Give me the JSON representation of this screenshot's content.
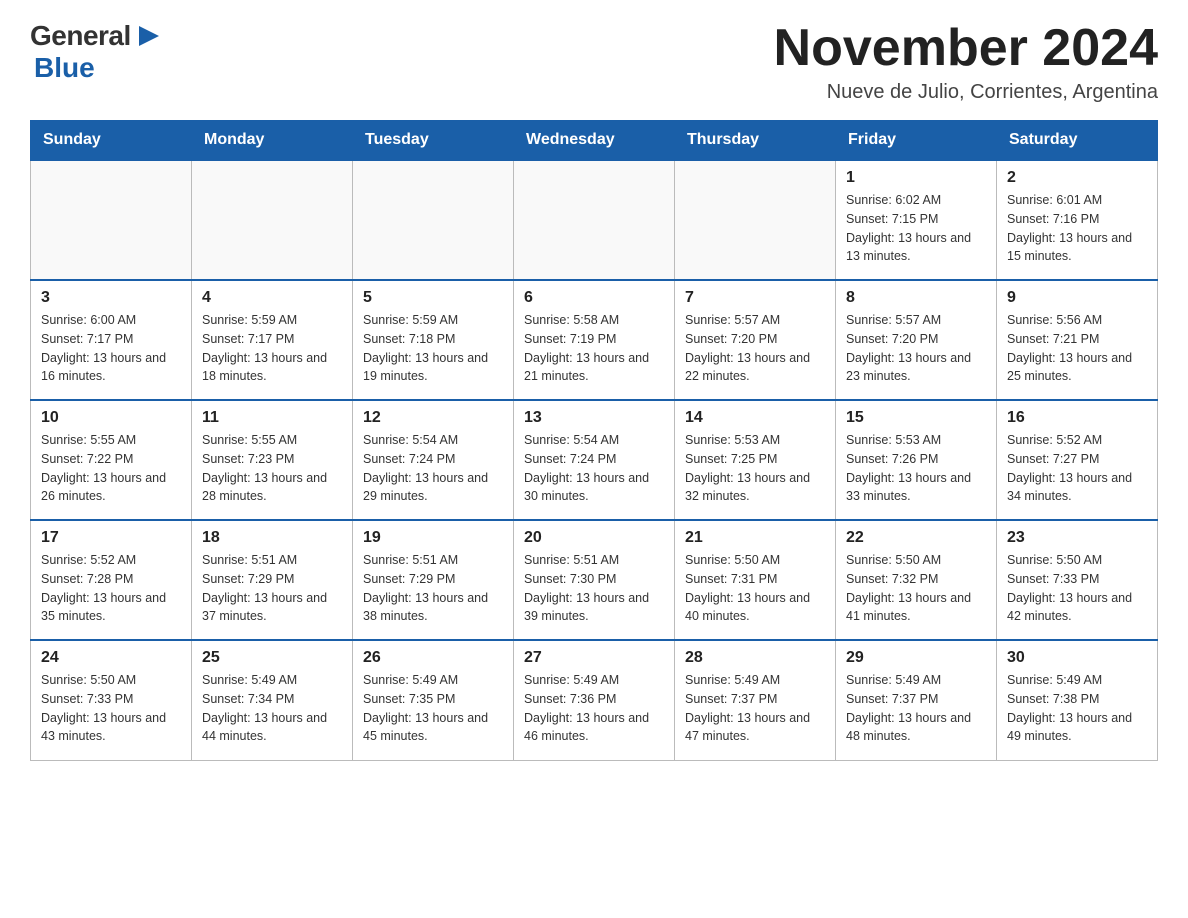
{
  "logo": {
    "general_text": "General",
    "blue_text": "Blue"
  },
  "header": {
    "month_year": "November 2024",
    "location": "Nueve de Julio, Corrientes, Argentina"
  },
  "days_of_week": [
    "Sunday",
    "Monday",
    "Tuesday",
    "Wednesday",
    "Thursday",
    "Friday",
    "Saturday"
  ],
  "weeks": [
    [
      {
        "day": "",
        "info": ""
      },
      {
        "day": "",
        "info": ""
      },
      {
        "day": "",
        "info": ""
      },
      {
        "day": "",
        "info": ""
      },
      {
        "day": "",
        "info": ""
      },
      {
        "day": "1",
        "info": "Sunrise: 6:02 AM\nSunset: 7:15 PM\nDaylight: 13 hours and 13 minutes."
      },
      {
        "day": "2",
        "info": "Sunrise: 6:01 AM\nSunset: 7:16 PM\nDaylight: 13 hours and 15 minutes."
      }
    ],
    [
      {
        "day": "3",
        "info": "Sunrise: 6:00 AM\nSunset: 7:17 PM\nDaylight: 13 hours and 16 minutes."
      },
      {
        "day": "4",
        "info": "Sunrise: 5:59 AM\nSunset: 7:17 PM\nDaylight: 13 hours and 18 minutes."
      },
      {
        "day": "5",
        "info": "Sunrise: 5:59 AM\nSunset: 7:18 PM\nDaylight: 13 hours and 19 minutes."
      },
      {
        "day": "6",
        "info": "Sunrise: 5:58 AM\nSunset: 7:19 PM\nDaylight: 13 hours and 21 minutes."
      },
      {
        "day": "7",
        "info": "Sunrise: 5:57 AM\nSunset: 7:20 PM\nDaylight: 13 hours and 22 minutes."
      },
      {
        "day": "8",
        "info": "Sunrise: 5:57 AM\nSunset: 7:20 PM\nDaylight: 13 hours and 23 minutes."
      },
      {
        "day": "9",
        "info": "Sunrise: 5:56 AM\nSunset: 7:21 PM\nDaylight: 13 hours and 25 minutes."
      }
    ],
    [
      {
        "day": "10",
        "info": "Sunrise: 5:55 AM\nSunset: 7:22 PM\nDaylight: 13 hours and 26 minutes."
      },
      {
        "day": "11",
        "info": "Sunrise: 5:55 AM\nSunset: 7:23 PM\nDaylight: 13 hours and 28 minutes."
      },
      {
        "day": "12",
        "info": "Sunrise: 5:54 AM\nSunset: 7:24 PM\nDaylight: 13 hours and 29 minutes."
      },
      {
        "day": "13",
        "info": "Sunrise: 5:54 AM\nSunset: 7:24 PM\nDaylight: 13 hours and 30 minutes."
      },
      {
        "day": "14",
        "info": "Sunrise: 5:53 AM\nSunset: 7:25 PM\nDaylight: 13 hours and 32 minutes."
      },
      {
        "day": "15",
        "info": "Sunrise: 5:53 AM\nSunset: 7:26 PM\nDaylight: 13 hours and 33 minutes."
      },
      {
        "day": "16",
        "info": "Sunrise: 5:52 AM\nSunset: 7:27 PM\nDaylight: 13 hours and 34 minutes."
      }
    ],
    [
      {
        "day": "17",
        "info": "Sunrise: 5:52 AM\nSunset: 7:28 PM\nDaylight: 13 hours and 35 minutes."
      },
      {
        "day": "18",
        "info": "Sunrise: 5:51 AM\nSunset: 7:29 PM\nDaylight: 13 hours and 37 minutes."
      },
      {
        "day": "19",
        "info": "Sunrise: 5:51 AM\nSunset: 7:29 PM\nDaylight: 13 hours and 38 minutes."
      },
      {
        "day": "20",
        "info": "Sunrise: 5:51 AM\nSunset: 7:30 PM\nDaylight: 13 hours and 39 minutes."
      },
      {
        "day": "21",
        "info": "Sunrise: 5:50 AM\nSunset: 7:31 PM\nDaylight: 13 hours and 40 minutes."
      },
      {
        "day": "22",
        "info": "Sunrise: 5:50 AM\nSunset: 7:32 PM\nDaylight: 13 hours and 41 minutes."
      },
      {
        "day": "23",
        "info": "Sunrise: 5:50 AM\nSunset: 7:33 PM\nDaylight: 13 hours and 42 minutes."
      }
    ],
    [
      {
        "day": "24",
        "info": "Sunrise: 5:50 AM\nSunset: 7:33 PM\nDaylight: 13 hours and 43 minutes."
      },
      {
        "day": "25",
        "info": "Sunrise: 5:49 AM\nSunset: 7:34 PM\nDaylight: 13 hours and 44 minutes."
      },
      {
        "day": "26",
        "info": "Sunrise: 5:49 AM\nSunset: 7:35 PM\nDaylight: 13 hours and 45 minutes."
      },
      {
        "day": "27",
        "info": "Sunrise: 5:49 AM\nSunset: 7:36 PM\nDaylight: 13 hours and 46 minutes."
      },
      {
        "day": "28",
        "info": "Sunrise: 5:49 AM\nSunset: 7:37 PM\nDaylight: 13 hours and 47 minutes."
      },
      {
        "day": "29",
        "info": "Sunrise: 5:49 AM\nSunset: 7:37 PM\nDaylight: 13 hours and 48 minutes."
      },
      {
        "day": "30",
        "info": "Sunrise: 5:49 AM\nSunset: 7:38 PM\nDaylight: 13 hours and 49 minutes."
      }
    ]
  ]
}
